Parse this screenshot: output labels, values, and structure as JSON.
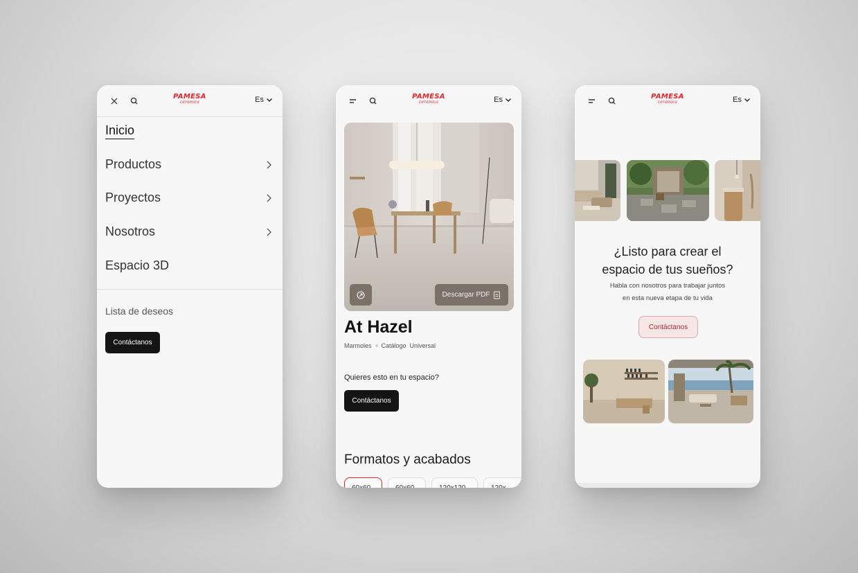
{
  "brand": {
    "logo_main": "PAMESA",
    "logo_sub": "cerámica",
    "red": "#e3262d"
  },
  "lang": {
    "label": "Es"
  },
  "menu_screen": {
    "items": [
      {
        "label": "Inicio"
      },
      {
        "label": "Productos"
      },
      {
        "label": "Proyectos"
      },
      {
        "label": "Nosotros"
      },
      {
        "label": "Espacio 3D"
      }
    ],
    "wishlist": "Lista de deseos",
    "contact_button": "Contáctanos"
  },
  "product_screen": {
    "download_pdf": "Descargar PDF",
    "title": "At Hazel",
    "breadcrumb": [
      "Marmoles",
      "Catálogo",
      "Universal"
    ],
    "question": "Quieres esto en tu espacio?",
    "contact_button": "Contáctanos",
    "formats_title": "Formatos y acabados",
    "chips": [
      "60x60",
      "60x60",
      "120x120",
      "120x"
    ]
  },
  "cta_screen": {
    "heading_line1": "¿Listo para crear el",
    "heading_line2": "espacio de tus sueños?",
    "text_line1": "Habla con nosotros para trabajar juntos",
    "text_line2": "en esta nueva etapa de tu vida",
    "contact_button": "Contáctanos"
  }
}
